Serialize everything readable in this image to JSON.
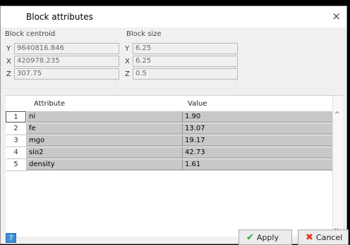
{
  "dialog": {
    "title": "Block attributes",
    "close_symbol": "×"
  },
  "centroid": {
    "label": "Block centroid",
    "axes": [
      "Y",
      "X",
      "Z"
    ],
    "values": [
      "9640816.846",
      "420978.235",
      "307.75"
    ]
  },
  "size": {
    "label": "Block size",
    "axes": [
      "Y",
      "X",
      "Z"
    ],
    "values": [
      "6.25",
      "6.25",
      "0.5"
    ]
  },
  "table": {
    "columns": [
      "Attribute",
      "Value"
    ],
    "rows": [
      {
        "n": "1",
        "attribute": "ni",
        "value": "1.90"
      },
      {
        "n": "2",
        "attribute": "fe",
        "value": "13.07"
      },
      {
        "n": "3",
        "attribute": "mgo",
        "value": "19.17"
      },
      {
        "n": "4",
        "attribute": "sio2",
        "value": "42.73"
      },
      {
        "n": "5",
        "attribute": "density",
        "value": "1.61"
      }
    ]
  },
  "buttons": {
    "help": "?",
    "apply": "Apply",
    "cancel": "Cancel"
  },
  "icons": {
    "apply": "check-icon",
    "cancel": "x-icon",
    "help": "help-icon"
  }
}
